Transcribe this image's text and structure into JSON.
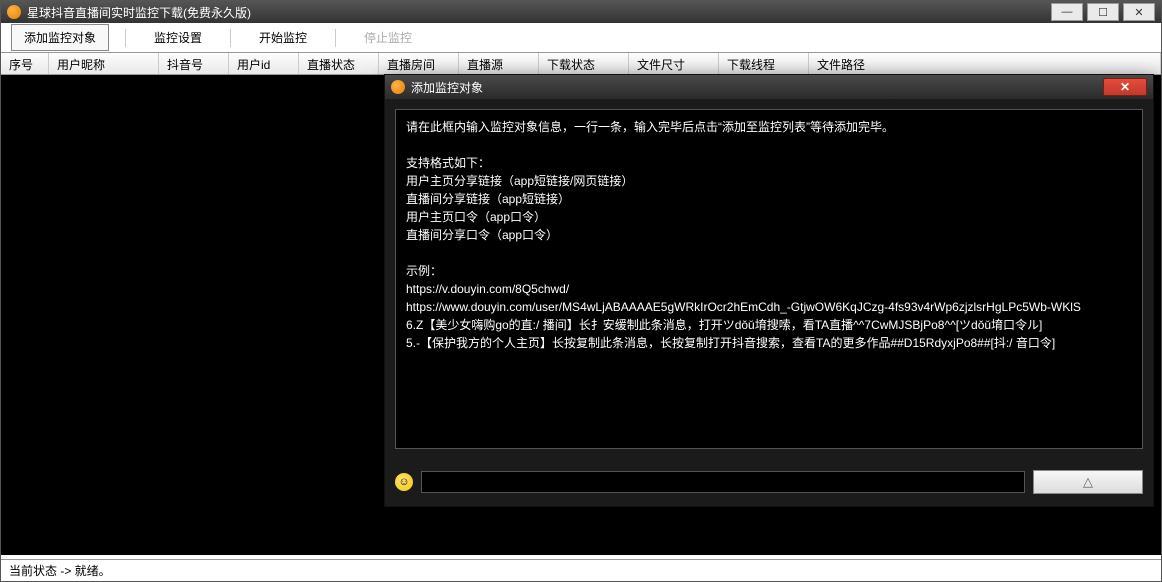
{
  "main": {
    "title": "星球抖音直播间实时监控下载(免费永久版)",
    "window_controls": {
      "min": "—",
      "max": "☐",
      "close": "✕"
    }
  },
  "toolbar": {
    "add": "添加监控对象",
    "settings": "监控设置",
    "start": "开始监控",
    "stop": "停止监控"
  },
  "columns": [
    "序号",
    "用户昵称",
    "抖音号",
    "用户id",
    "直播状态",
    "直播房间",
    "直播源",
    "下载状态",
    "文件尺寸",
    "下载线程",
    "文件路径"
  ],
  "status": "当前状态 -> 就绪。",
  "dialog": {
    "title": "添加监控对象",
    "textarea": "请在此框内输入监控对象信息，一行一条，输入完毕后点击“添加至监控列表”等待添加完毕。\n\n支持格式如下：\n用户主页分享链接（app短链接/网页链接）\n直播间分享链接（app短链接）\n用户主页口令（app口令）\n直播间分享口令（app口令）\n\n示例：\nhttps://v.douyin.com/8Q5chwd/\nhttps://www.douyin.com/user/MS4wLjABAAAAE5gWRkIrOcr2hEmCdh_-GtjwOW6KqJCzg-4fs93v4rWp6zjzlsrHgLPc5Wb-WKlS\n6.Z【美少女嗨购go的直:/ 播间】长扌安缓制此条消息，打开ツdǒǔ堉搜嗦，看TA直播^^7CwMJSBjPo8^^[ツdǒǔ堉口令ル]\n5.-【保护我方的个人主页】长按复制此条消息，长按复制打开抖音搜索，查看TA的更多作品##D15RdyxjPo8##[抖:/ 音口令]",
    "input_value": "",
    "submit_icon": "△"
  }
}
